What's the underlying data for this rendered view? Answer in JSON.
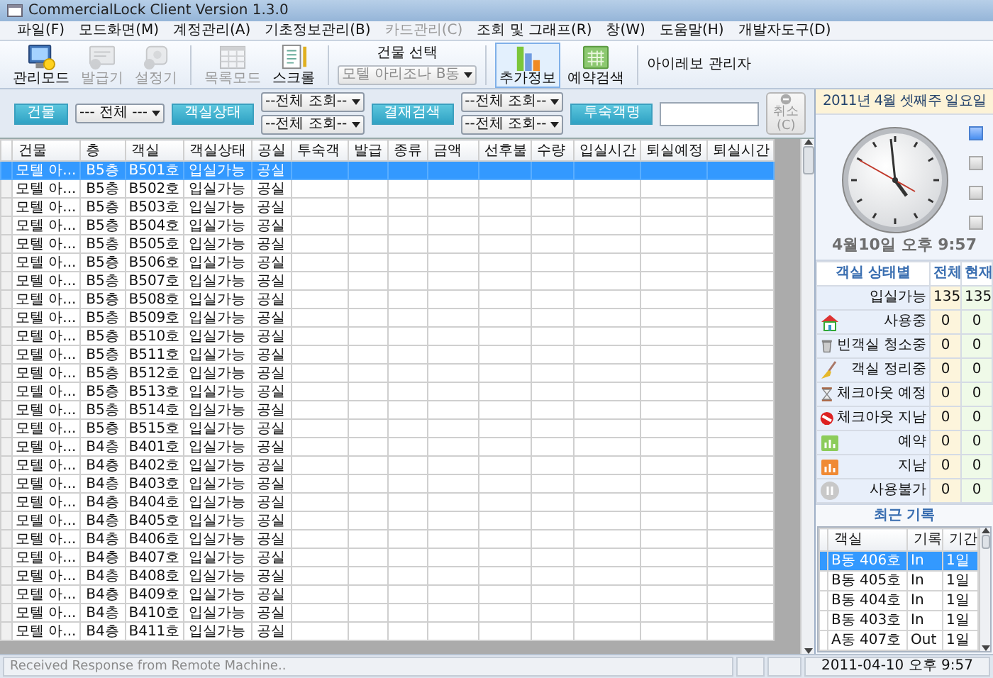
{
  "window": {
    "title": "CommercialLock Client Version 1.3.0"
  },
  "menu": [
    {
      "label": "파일(F)",
      "disabled": false
    },
    {
      "label": "모드화면(M)",
      "disabled": false
    },
    {
      "label": "계정관리(A)",
      "disabled": false
    },
    {
      "label": "기초정보관리(B)",
      "disabled": false
    },
    {
      "label": "카드관리(C)",
      "disabled": true
    },
    {
      "label": "조회 및 그래프(R)",
      "disabled": false
    },
    {
      "label": "창(W)",
      "disabled": false
    },
    {
      "label": "도움말(H)",
      "disabled": false
    },
    {
      "label": "개발자도구(D)",
      "disabled": false
    }
  ],
  "toolbar": {
    "groups": [
      [
        {
          "label": "관리모드",
          "disabled": false,
          "selected": false
        },
        {
          "label": "발급기",
          "disabled": true,
          "selected": false
        },
        {
          "label": "설정기",
          "disabled": true,
          "selected": false
        }
      ],
      [
        {
          "label": "목록모드",
          "disabled": true,
          "selected": false
        },
        {
          "label": "스크롤",
          "disabled": false,
          "selected": false
        }
      ]
    ],
    "building_select": {
      "label": "건물 선택",
      "value": "모텔 아리조나 B동",
      "disabled": true
    },
    "tools_right": [
      {
        "label": "추가정보",
        "disabled": false,
        "selected": true
      },
      {
        "label": "예약검색",
        "disabled": false,
        "selected": false
      }
    ],
    "user": "아이레보 관리자"
  },
  "filters": [
    {
      "kind": "button",
      "label": "건물"
    },
    {
      "kind": "select",
      "value": "--- 전체 ---"
    },
    {
      "kind": "button",
      "label": "객실상태"
    },
    {
      "kind": "select_pair",
      "values": [
        "--전체 조회--",
        "--전체 조회--"
      ]
    },
    {
      "kind": "button",
      "label": "결재검색"
    },
    {
      "kind": "select_pair",
      "values": [
        "--전체 조회--",
        "--전체 조회--"
      ]
    },
    {
      "kind": "button",
      "label": "투숙객명"
    },
    {
      "kind": "input"
    }
  ],
  "cancel_button": {
    "label": "취소(C)",
    "disabled": true
  },
  "grid": {
    "columns": [
      "건물",
      "층",
      "객실",
      "객실상태",
      "공실",
      "투숙객",
      "발급",
      "종류",
      "금액",
      "선후불",
      "수량",
      "입실시간",
      "퇴실예정",
      "퇴실시간"
    ],
    "rows": [
      {
        "cells": [
          "모텔 아...",
          "B5층",
          "B501호",
          "입실가능",
          "공실"
        ],
        "selected": true
      },
      {
        "cells": [
          "모텔 아...",
          "B5층",
          "B502호",
          "입실가능",
          "공실"
        ],
        "selected": false
      },
      {
        "cells": [
          "모텔 아...",
          "B5층",
          "B503호",
          "입실가능",
          "공실"
        ],
        "selected": false
      },
      {
        "cells": [
          "모텔 아...",
          "B5층",
          "B504호",
          "입실가능",
          "공실"
        ],
        "selected": false
      },
      {
        "cells": [
          "모텔 아...",
          "B5층",
          "B505호",
          "입실가능",
          "공실"
        ],
        "selected": false
      },
      {
        "cells": [
          "모텔 아...",
          "B5층",
          "B506호",
          "입실가능",
          "공실"
        ],
        "selected": false
      },
      {
        "cells": [
          "모텔 아...",
          "B5층",
          "B507호",
          "입실가능",
          "공실"
        ],
        "selected": false
      },
      {
        "cells": [
          "모텔 아...",
          "B5층",
          "B508호",
          "입실가능",
          "공실"
        ],
        "selected": false
      },
      {
        "cells": [
          "모텔 아...",
          "B5층",
          "B509호",
          "입실가능",
          "공실"
        ],
        "selected": false
      },
      {
        "cells": [
          "모텔 아...",
          "B5층",
          "B510호",
          "입실가능",
          "공실"
        ],
        "selected": false
      },
      {
        "cells": [
          "모텔 아...",
          "B5층",
          "B511호",
          "입실가능",
          "공실"
        ],
        "selected": false
      },
      {
        "cells": [
          "모텔 아...",
          "B5층",
          "B512호",
          "입실가능",
          "공실"
        ],
        "selected": false
      },
      {
        "cells": [
          "모텔 아...",
          "B5층",
          "B513호",
          "입실가능",
          "공실"
        ],
        "selected": false
      },
      {
        "cells": [
          "모텔 아...",
          "B5층",
          "B514호",
          "입실가능",
          "공실"
        ],
        "selected": false
      },
      {
        "cells": [
          "모텔 아...",
          "B5층",
          "B515호",
          "입실가능",
          "공실"
        ],
        "selected": false
      },
      {
        "cells": [
          "모텔 아...",
          "B4층",
          "B401호",
          "입실가능",
          "공실"
        ],
        "selected": false
      },
      {
        "cells": [
          "모텔 아...",
          "B4층",
          "B402호",
          "입실가능",
          "공실"
        ],
        "selected": false
      },
      {
        "cells": [
          "모텔 아...",
          "B4층",
          "B403호",
          "입실가능",
          "공실"
        ],
        "selected": false
      },
      {
        "cells": [
          "모텔 아...",
          "B4층",
          "B404호",
          "입실가능",
          "공실"
        ],
        "selected": false
      },
      {
        "cells": [
          "모텔 아...",
          "B4층",
          "B405호",
          "입실가능",
          "공실"
        ],
        "selected": false
      },
      {
        "cells": [
          "모텔 아...",
          "B4층",
          "B406호",
          "입실가능",
          "공실"
        ],
        "selected": false
      },
      {
        "cells": [
          "모텔 아...",
          "B4층",
          "B407호",
          "입실가능",
          "공실"
        ],
        "selected": false
      },
      {
        "cells": [
          "모텔 아...",
          "B4층",
          "B408호",
          "입실가능",
          "공실"
        ],
        "selected": false
      },
      {
        "cells": [
          "모텔 아...",
          "B4층",
          "B409호",
          "입실가능",
          "공실"
        ],
        "selected": false
      },
      {
        "cells": [
          "모텔 아...",
          "B4층",
          "B410호",
          "입실가능",
          "공실"
        ],
        "selected": false
      },
      {
        "cells": [
          "모텔 아...",
          "B4층",
          "B411호",
          "입실가능",
          "공실"
        ],
        "selected": false
      }
    ]
  },
  "clock_panel": {
    "date_header": "2011년 4월 셋째주 일요일",
    "view_buttons": [
      {
        "selected": true
      },
      {
        "selected": false
      },
      {
        "selected": false
      },
      {
        "selected": false
      }
    ],
    "date_time": "4월10일 오후 9:57"
  },
  "room_status": {
    "columns": [
      "객실 상태별",
      "전체",
      "현재"
    ],
    "rows": [
      {
        "label": "입실가능",
        "total": "135",
        "current": "135"
      },
      {
        "label": "사용중",
        "total": "0",
        "current": "0"
      },
      {
        "label": "빈객실 청소중",
        "total": "0",
        "current": "0"
      },
      {
        "label": "객실 정리중",
        "total": "0",
        "current": "0"
      },
      {
        "label": "체크아웃 예정",
        "total": "0",
        "current": "0"
      },
      {
        "label": "체크아웃 지남",
        "total": "0",
        "current": "0"
      },
      {
        "label": "예약",
        "total": "0",
        "current": "0"
      },
      {
        "label": "지남",
        "total": "0",
        "current": "0"
      },
      {
        "label": "사용불가",
        "total": "0",
        "current": "0"
      }
    ]
  },
  "recent_log": {
    "title": "최근 기록",
    "columns": [
      "객실",
      "기록",
      "기간"
    ],
    "rows": [
      {
        "room": "B동 406호",
        "record": "In",
        "period": "1일",
        "selected": true
      },
      {
        "room": "B동 405호",
        "record": "In",
        "period": "1일",
        "selected": false
      },
      {
        "room": "B동 404호",
        "record": "In",
        "period": "1일",
        "selected": false
      },
      {
        "room": "B동 403호",
        "record": "In",
        "period": "1일",
        "selected": false
      },
      {
        "room": "A동 407호",
        "record": "Out",
        "period": "1일",
        "selected": false
      }
    ]
  },
  "status_bar": {
    "message": "Received Response from Remote Machine..",
    "date_time": "2011-04-10 오후 9:57"
  }
}
